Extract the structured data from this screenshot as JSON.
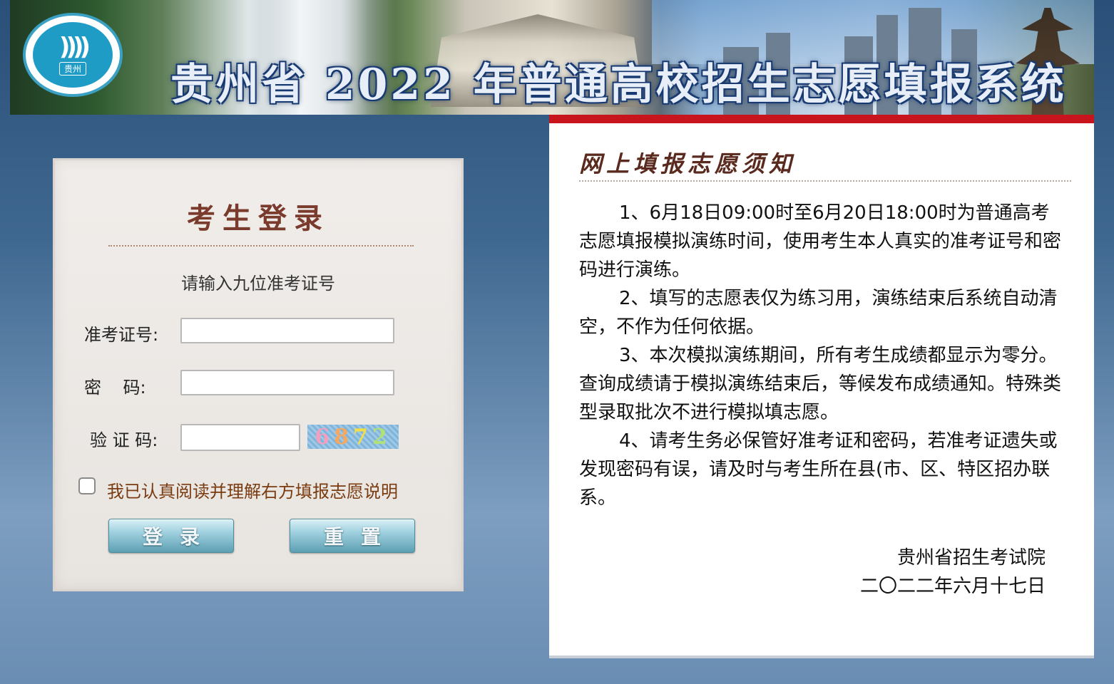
{
  "banner": {
    "logo_tag": "贵州",
    "logo_waves": "))))",
    "title": "贵州省 2022 年普通高校招生志愿填报系统"
  },
  "login": {
    "title": "考生登录",
    "hint": "请输入九位准考证号",
    "exam_id_label": "准考证号:",
    "exam_id_value": "",
    "password_label": "密    码:",
    "password_value": "",
    "captcha_label": "验 证 码:",
    "captcha_value": "",
    "captcha_digits": [
      "6",
      "8",
      "7",
      "2"
    ],
    "agree_checked": false,
    "agree_label": "我已认真阅读并理解右方填报志愿说明",
    "login_button": "登录",
    "reset_button": "重置"
  },
  "notice": {
    "title": "网上填报志愿须知",
    "items": [
      "1、6月18日09:00时至6月20日18:00时为普通高考志愿填报模拟演练时间，使用考生本人真实的准考证号和密码进行演练。",
      "2、填写的志愿表仅为练习用，演练结束后系统自动清空，不作为任何依据。",
      "3、本次模拟演练期间，所有考生成绩都显示为零分。查询成绩请于模拟演练结束后，等候发布成绩通知。特殊类型录取批次不进行模拟填志愿。",
      "4、请考生务必保管好准考证和密码，若准考证遗失或发现密码有误，请及时与考生所在县(市、区、特区招办联系。"
    ],
    "signature_org": "贵州省招生考试院",
    "signature_date": "二〇二二年六月十七日"
  },
  "colors": {
    "accent_red": "#c8141d",
    "login_title": "#7a3b2d",
    "agree_text": "#7a3b10",
    "button_teal": "#5d9fb2"
  }
}
